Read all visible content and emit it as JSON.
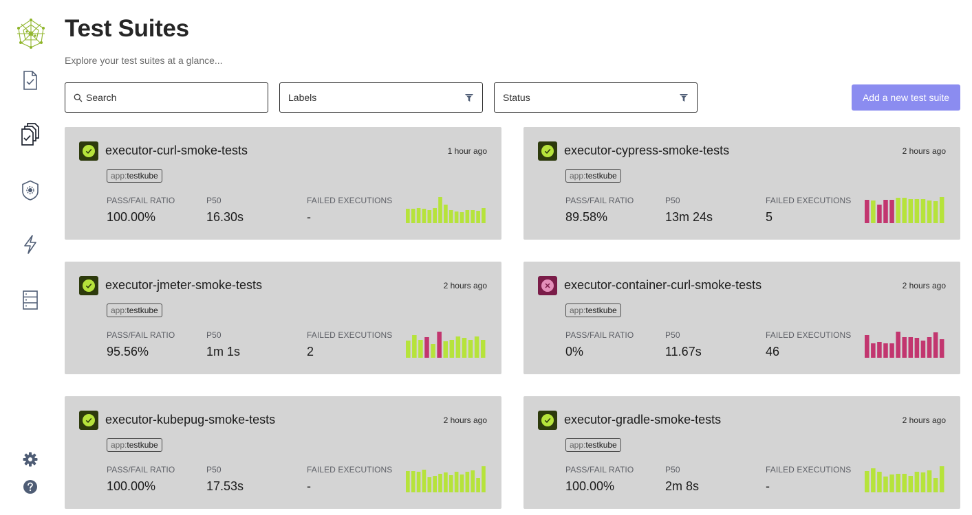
{
  "page": {
    "title": "Test Suites",
    "subtitle": "Explore your test suites at a glance..."
  },
  "filters": {
    "search_placeholder": "Search",
    "labels_placeholder": "Labels",
    "status_placeholder": "Status"
  },
  "actions": {
    "add_label": "Add a new test suite"
  },
  "sidebar": {
    "items": [
      {
        "name": "tests",
        "icon": "test-document-icon"
      },
      {
        "name": "test-suites",
        "icon": "test-suites-stack-icon"
      },
      {
        "name": "executors",
        "icon": "executor-shield-icon"
      },
      {
        "name": "triggers",
        "icon": "lightning-icon"
      },
      {
        "name": "sources",
        "icon": "database-icon"
      }
    ],
    "bottom": [
      {
        "name": "settings",
        "icon": "gear-icon"
      },
      {
        "name": "help",
        "icon": "help-icon"
      }
    ]
  },
  "metric_labels": {
    "ratio": "PASS/FAIL RATIO",
    "p50": "P50",
    "failed": "FAILED EXECUTIONS"
  },
  "colors": {
    "pass": "#b6e33b",
    "fail": "#c2366f",
    "card_bg": "#d4d4d4",
    "accent": "#8b8cf0"
  },
  "suites": [
    {
      "name": "executor-curl-smoke-tests",
      "time": "1 hour ago",
      "status": "passed",
      "tag_key": "app:",
      "tag_value": "testkube",
      "ratio": "100.00%",
      "p50": "16.30s",
      "failed": "-",
      "bars": [
        {
          "v": 0.55,
          "s": "pass"
        },
        {
          "v": 0.55,
          "s": "pass"
        },
        {
          "v": 0.58,
          "s": "pass"
        },
        {
          "v": 0.55,
          "s": "pass"
        },
        {
          "v": 0.5,
          "s": "pass"
        },
        {
          "v": 0.58,
          "s": "pass"
        },
        {
          "v": 1.0,
          "s": "pass"
        },
        {
          "v": 0.72,
          "s": "pass"
        },
        {
          "v": 0.5,
          "s": "pass"
        },
        {
          "v": 0.45,
          "s": "pass"
        },
        {
          "v": 0.42,
          "s": "pass"
        },
        {
          "v": 0.5,
          "s": "pass"
        },
        {
          "v": 0.5,
          "s": "pass"
        },
        {
          "v": 0.48,
          "s": "pass"
        },
        {
          "v": 0.58,
          "s": "pass"
        }
      ]
    },
    {
      "name": "executor-cypress-smoke-tests",
      "time": "2 hours ago",
      "status": "passed",
      "tag_key": "app:",
      "tag_value": "testkube",
      "ratio": "89.58%",
      "p50": "13m 24s",
      "failed": "5",
      "bars": [
        {
          "v": 0.9,
          "s": "fail"
        },
        {
          "v": 0.86,
          "s": "pass"
        },
        {
          "v": 0.72,
          "s": "fail"
        },
        {
          "v": 0.9,
          "s": "fail"
        },
        {
          "v": 0.9,
          "s": "fail"
        },
        {
          "v": 0.97,
          "s": "pass"
        },
        {
          "v": 0.97,
          "s": "pass"
        },
        {
          "v": 0.92,
          "s": "pass"
        },
        {
          "v": 0.92,
          "s": "pass"
        },
        {
          "v": 0.92,
          "s": "pass"
        },
        {
          "v": 0.88,
          "s": "pass"
        },
        {
          "v": 0.85,
          "s": "pass"
        },
        {
          "v": 1.0,
          "s": "pass"
        }
      ]
    },
    {
      "name": "executor-jmeter-smoke-tests",
      "time": "2 hours ago",
      "status": "passed",
      "tag_key": "app:",
      "tag_value": "testkube",
      "ratio": "95.56%",
      "p50": "1m 1s",
      "failed": "2",
      "bars": [
        {
          "v": 0.65,
          "s": "pass"
        },
        {
          "v": 0.88,
          "s": "pass"
        },
        {
          "v": 0.68,
          "s": "pass"
        },
        {
          "v": 0.78,
          "s": "fail"
        },
        {
          "v": 0.52,
          "s": "pass"
        },
        {
          "v": 1.0,
          "s": "fail"
        },
        {
          "v": 0.62,
          "s": "pass"
        },
        {
          "v": 0.68,
          "s": "pass"
        },
        {
          "v": 0.82,
          "s": "pass"
        },
        {
          "v": 0.75,
          "s": "pass"
        },
        {
          "v": 0.68,
          "s": "pass"
        },
        {
          "v": 0.82,
          "s": "pass"
        },
        {
          "v": 0.68,
          "s": "pass"
        }
      ]
    },
    {
      "name": "executor-container-curl-smoke-tests",
      "time": "2 hours ago",
      "status": "failed",
      "tag_key": "app:",
      "tag_value": "testkube",
      "ratio": "0%",
      "p50": "11.67s",
      "failed": "46",
      "bars": [
        {
          "v": 0.88,
          "s": "fail"
        },
        {
          "v": 0.55,
          "s": "fail"
        },
        {
          "v": 0.6,
          "s": "fail"
        },
        {
          "v": 0.55,
          "s": "fail"
        },
        {
          "v": 0.55,
          "s": "fail"
        },
        {
          "v": 1.0,
          "s": "fail"
        },
        {
          "v": 0.78,
          "s": "fail"
        },
        {
          "v": 0.8,
          "s": "fail"
        },
        {
          "v": 0.75,
          "s": "fail"
        },
        {
          "v": 0.65,
          "s": "fail"
        },
        {
          "v": 0.78,
          "s": "fail"
        },
        {
          "v": 0.98,
          "s": "fail"
        },
        {
          "v": 0.72,
          "s": "fail"
        }
      ]
    },
    {
      "name": "executor-kubepug-smoke-tests",
      "time": "2 hours ago",
      "status": "passed",
      "tag_key": "app:",
      "tag_value": "testkube",
      "ratio": "100.00%",
      "p50": "17.53s",
      "failed": "-",
      "bars": [
        {
          "v": 0.82,
          "s": "pass"
        },
        {
          "v": 0.82,
          "s": "pass"
        },
        {
          "v": 0.78,
          "s": "pass"
        },
        {
          "v": 0.88,
          "s": "pass"
        },
        {
          "v": 0.58,
          "s": "pass"
        },
        {
          "v": 0.62,
          "s": "pass"
        },
        {
          "v": 0.72,
          "s": "pass"
        },
        {
          "v": 0.75,
          "s": "pass"
        },
        {
          "v": 0.65,
          "s": "pass"
        },
        {
          "v": 0.78,
          "s": "pass"
        },
        {
          "v": 0.68,
          "s": "pass"
        },
        {
          "v": 0.78,
          "s": "pass"
        },
        {
          "v": 0.85,
          "s": "pass"
        },
        {
          "v": 0.55,
          "s": "pass"
        },
        {
          "v": 1.0,
          "s": "pass"
        }
      ]
    },
    {
      "name": "executor-gradle-smoke-tests",
      "time": "2 hours ago",
      "status": "passed",
      "tag_key": "app:",
      "tag_value": "testkube",
      "ratio": "100.00%",
      "p50": "2m 8s",
      "failed": "-",
      "bars": [
        {
          "v": 0.82,
          "s": "pass"
        },
        {
          "v": 0.92,
          "s": "pass"
        },
        {
          "v": 0.8,
          "s": "pass"
        },
        {
          "v": 0.6,
          "s": "pass"
        },
        {
          "v": 0.68,
          "s": "pass"
        },
        {
          "v": 0.72,
          "s": "pass"
        },
        {
          "v": 0.72,
          "s": "pass"
        },
        {
          "v": 0.62,
          "s": "pass"
        },
        {
          "v": 0.8,
          "s": "pass"
        },
        {
          "v": 0.75,
          "s": "pass"
        },
        {
          "v": 0.85,
          "s": "pass"
        },
        {
          "v": 0.55,
          "s": "pass"
        },
        {
          "v": 1.0,
          "s": "pass"
        }
      ]
    }
  ]
}
